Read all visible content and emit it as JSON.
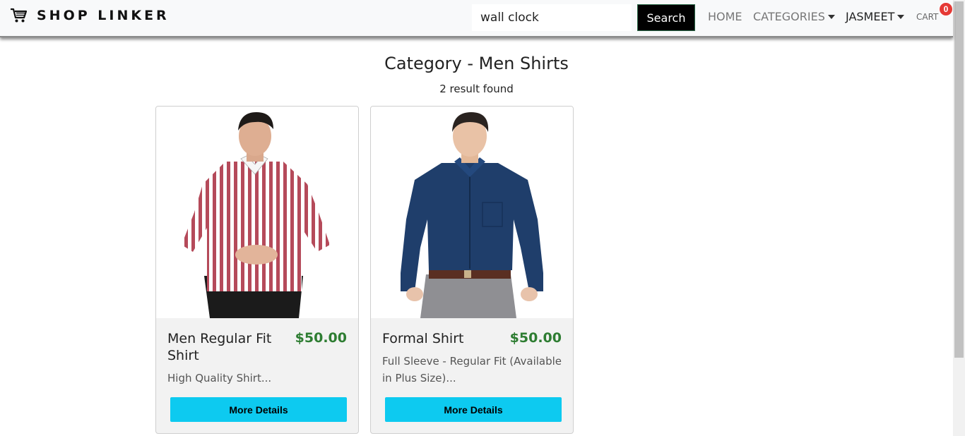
{
  "navbar": {
    "brand": "SHOP LINKER",
    "brand_icon": "cart-icon",
    "search_value": "wall clock",
    "search_button": "Search",
    "home": "HOME",
    "categories": "CATEGORIES",
    "user": "JASMEET",
    "cart": "CART",
    "cart_count": "0"
  },
  "page": {
    "title": "Category - Men Shirts",
    "result_count": "2 result found"
  },
  "products": [
    {
      "title": "Men Regular Fit Shirt",
      "price": "$50.00",
      "description": "High Quality Shirt...",
      "button": "More Details",
      "image": "red-striped-shirt-photo"
    },
    {
      "title": "Formal Shirt",
      "price": "$50.00",
      "description": "Full Sleeve - Regular Fit (Available in Plus Size)...",
      "button": "More Details",
      "image": "navy-formal-shirt-photo"
    }
  ],
  "colors": {
    "price": "#2e7d32",
    "details_button": "#0dcaf0",
    "cart_badge": "#e53935"
  }
}
